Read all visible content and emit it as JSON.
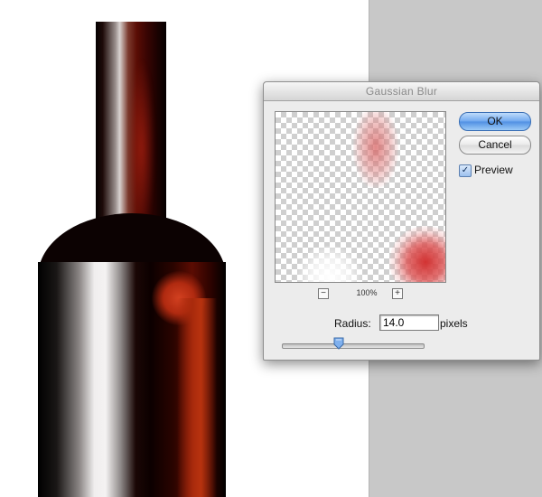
{
  "dialog": {
    "title": "Gaussian Blur",
    "ok_label": "OK",
    "cancel_label": "Cancel",
    "preview_label": "Preview",
    "preview_checked": true,
    "zoom_level": "100%",
    "zoom_out_symbol": "−",
    "zoom_in_symbol": "+",
    "radius_label": "Radius:",
    "radius_value": "14.0",
    "radius_unit": "pixels",
    "slider_fraction": 0.4,
    "accent_color": "#4f8fe3"
  },
  "canvas": {
    "subject": "wine-bottle-image",
    "pasteboard_color": "#c8c8c8"
  }
}
